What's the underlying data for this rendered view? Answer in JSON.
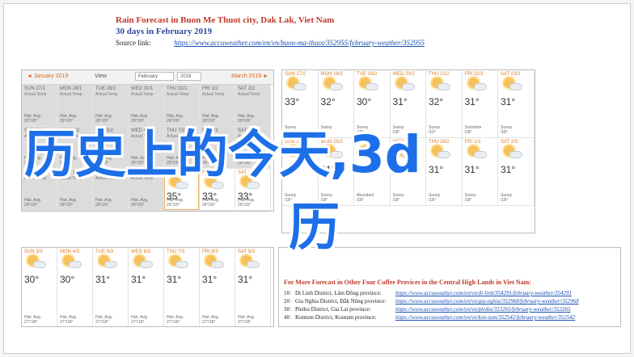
{
  "header": {
    "title": "Rain Forecast in Buon Me Thuot city, Dak Lak, Viet Nam",
    "subtitle": "30 days in February 2019",
    "source_label": "Source link:",
    "source_url": "https://www.accuweather.com/en/vn/buon-ma-thuot/352955/february-weather/352955"
  },
  "calendar_main": {
    "prev_label": "◄ January 2019",
    "next_label": "March 2019 ►",
    "view_label": "View",
    "month_select": "February",
    "year_select": "2019",
    "rows": [
      [
        {
          "day": "SUN 27/1",
          "kind": "past",
          "fc": "Actual Temp",
          "lo": "Hist. Avg.\n29°/20°"
        },
        {
          "day": "MON 28/1",
          "kind": "past",
          "fc": "Actual Temp",
          "lo": "Hist. Avg.\n29°/20°"
        },
        {
          "day": "TUE 29/1",
          "kind": "past",
          "fc": "Actual Temp",
          "lo": "Hist. Avg.\n29°/20°"
        },
        {
          "day": "WED 30/1",
          "kind": "past",
          "fc": "Actual Temp",
          "lo": "Hist. Avg.\n29°/20°"
        },
        {
          "day": "THU 31/1",
          "kind": "past",
          "fc": "Actual Temp",
          "lo": "Hist. Avg.\n29°/20°"
        },
        {
          "day": "FRI 1/2",
          "kind": "past",
          "fc": "Actual Temp",
          "lo": "Hist. Avg.\n29°/20°"
        },
        {
          "day": "SAT 2/2",
          "kind": "past",
          "fc": "Actual Temp",
          "lo": "Hist. Avg.\n29°/20°"
        }
      ],
      [
        {
          "day": "SUN 3/2",
          "kind": "past",
          "fc": "Actual Temp",
          "lo": "Hist. Avg.\n29°/20°"
        },
        {
          "day": "MON 4/2",
          "kind": "past",
          "fc": "Actual Temp",
          "lo": "Hist. Avg.\n29°/20°"
        },
        {
          "day": "TUE 5/2",
          "kind": "past",
          "fc": "Actual Temp",
          "lo": "Hist. Avg.\n29°/20°"
        },
        {
          "day": "WED 6/2",
          "kind": "past",
          "fc": "Actual Temp",
          "lo": "Hist. Avg.\n29°/20°"
        },
        {
          "day": "THU 7/2",
          "kind": "past",
          "fc": "Actual Temp",
          "lo": "Hist. Avg.\n29°/20°"
        },
        {
          "day": "FRI 8/2",
          "kind": "past",
          "fc": "Actual Temp",
          "lo": "Hist. Avg.\n29°/20°"
        },
        {
          "day": "SAT 9/2",
          "kind": "past",
          "fc": "Actual Temp",
          "lo": "Hist. Avg.\n29°/20°"
        }
      ],
      [
        {
          "day": "SUN 10/2",
          "kind": "past",
          "fc": "Actual Temp",
          "lo": "Hist. Avg.\n29°/20°"
        },
        {
          "day": "MON 11/2",
          "kind": "past",
          "fc": "Actual Temp",
          "lo": "Hist. Avg.\n29°/20°"
        },
        {
          "day": "TUE 12/2",
          "kind": "past",
          "fc": "Actual Temp",
          "lo": "Hist. Avg.\n29°/20°"
        },
        {
          "day": "WED 13/2",
          "kind": "past",
          "fc": "Actual Temp",
          "lo": "Hist. Avg.\n29°/20°"
        },
        {
          "day": "TODAY",
          "kind": "today",
          "temp": "35°",
          "lo": "Hist. Avg.\n29°/20°"
        },
        {
          "day": "FRI 15/2",
          "kind": "future",
          "temp": "33°",
          "lo": "Hist. Avg.\n29°/20°"
        },
        {
          "day": "SAT 16/2",
          "kind": "future",
          "temp": "33°",
          "lo": "Hist. Avg.\n29°/20°"
        }
      ]
    ]
  },
  "calendar_right": {
    "rows": [
      [
        {
          "day": "SUN 17/2",
          "temp": "33°",
          "lo": "Sunny\n/18°"
        },
        {
          "day": "MON 18/2",
          "temp": "32°",
          "lo": "Sunny\n/19°"
        },
        {
          "day": "TUE 19/2",
          "temp": "30°",
          "lo": "Sunny\n/18°"
        },
        {
          "day": "WED 20/2",
          "temp": "31°",
          "lo": "Sunny\n/18°"
        },
        {
          "day": "THU 21/2",
          "temp": "32°",
          "lo": "Sunny\n/19°"
        },
        {
          "day": "FRI 22/2",
          "temp": "31°",
          "lo": "Sunshine\n/18°"
        },
        {
          "day": "SAT 23/2",
          "temp": "31°",
          "lo": "Sunny\n/18°"
        }
      ],
      [
        {
          "day": "SUN 24/2",
          "temp": "31°",
          "lo": "Sunny\n/18°"
        },
        {
          "day": "MON 25/2",
          "temp": "31°",
          "lo": "Sunny\n/18°"
        },
        {
          "day": "TUE 26/2",
          "temp": "31°",
          "lo": "Abundant\n/18°"
        },
        {
          "day": "WED 27/2",
          "temp": "31°",
          "lo": "Sunny\n/18°"
        },
        {
          "day": "THU 28/2",
          "temp": "31°",
          "lo": "Sunny\n/18°"
        },
        {
          "day": "FRI 1/3",
          "temp": "31°",
          "lo": "Sunny\n/18°"
        },
        {
          "day": "SAT 2/3",
          "temp": "31°",
          "lo": "Sunny\n/18°"
        }
      ]
    ]
  },
  "calendar_bottom": {
    "cells": [
      {
        "day": "SUN 3/3",
        "temp": "30°",
        "lo": "Hist. Avg.\n27°/18°"
      },
      {
        "day": "MON 4/3",
        "temp": "30°",
        "lo": "Hist. Avg.\n27°/18°"
      },
      {
        "day": "TUE 5/3",
        "temp": "31°",
        "lo": "Hist. Avg.\n27°/18°"
      },
      {
        "day": "WED 6/3",
        "temp": "31°",
        "lo": "Hist. Avg.\n27°/18°"
      },
      {
        "day": "THU 7/3",
        "temp": "31°",
        "lo": "Hist. Avg.\n27°/18°"
      },
      {
        "day": "FRI 8/3",
        "temp": "31°",
        "lo": "Hist. Avg.\n27°/18°"
      },
      {
        "day": "SAT 9/3",
        "temp": "31°",
        "lo": "Hist. Avg.\n27°/18°"
      }
    ]
  },
  "more": {
    "title": "For More Forecast in Other Four Coffee Provices in the Central High Lands in Viet Nam:",
    "items": [
      {
        "n": "1#:",
        "name": "Di Linh District, Lâm Đồng province:",
        "url": "https://www.accuweather.com/en/vn/di-linh/354291/february-weather/354291"
      },
      {
        "n": "2#:",
        "name": "Gia Nghia District, Đắk Nông province:",
        "url": "https://www.accuweather.com/en/vn/gia-nghia/352968/february-weather/352968"
      },
      {
        "n": "3#:",
        "name": "Pleiku District, Gia Lai province:",
        "url": "https://www.accuweather.com/en/vn/pleiku/353265/february-weather/353265"
      },
      {
        "n": "4#:",
        "name": "Kontum District, Kontum province:",
        "url": "https://www.accuweather.com/en/vn/kon-tum/352542/february-weather/352542"
      }
    ]
  },
  "watermark": {
    "line1": "历史上的今天,3d",
    "line2": "历",
    "color": "#1c6fe8"
  }
}
